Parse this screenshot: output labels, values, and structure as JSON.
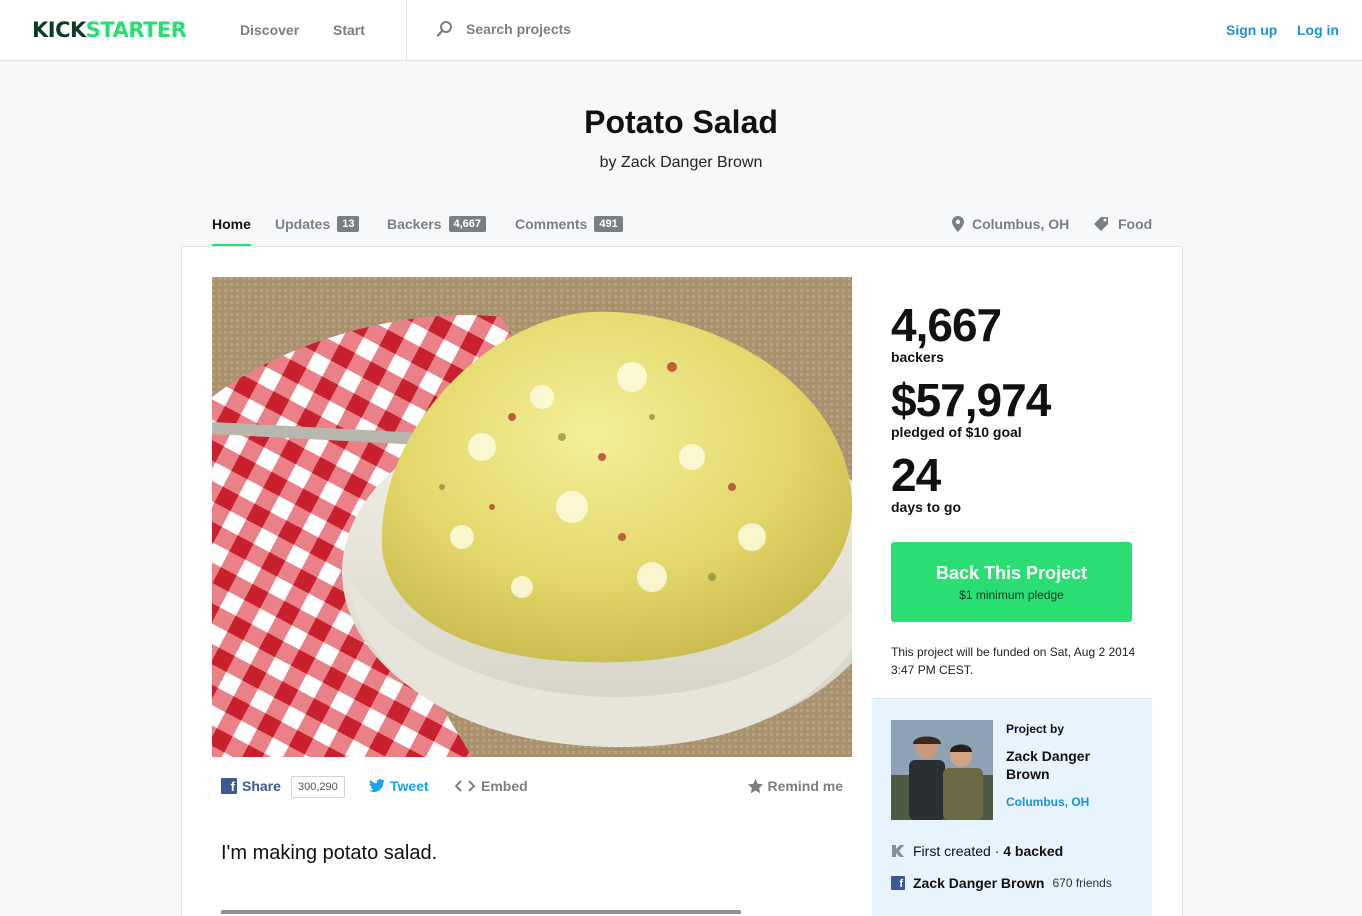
{
  "header": {
    "logo_part1": "KICK",
    "logo_part2": "STARTER",
    "nav": [
      "Discover",
      "Start"
    ],
    "search_placeholder": "Search projects",
    "signup": "Sign up",
    "login": "Log in"
  },
  "project": {
    "title": "Potato Salad",
    "byline": "by Zack Danger Brown"
  },
  "tabs": [
    {
      "label": "Home",
      "count": ""
    },
    {
      "label": "Updates",
      "count": "13"
    },
    {
      "label": "Backers",
      "count": "4,667"
    },
    {
      "label": "Comments",
      "count": "491"
    }
  ],
  "meta": {
    "location": "Columbus, OH",
    "category": "Food"
  },
  "stats": {
    "backers": "4,667",
    "backers_label": "backers",
    "pledged": "$57,974",
    "pledged_label": "pledged of $10 goal",
    "days": "24",
    "days_label": "days to go"
  },
  "back_button": {
    "title": "Back This Project",
    "subtitle": "$1 minimum pledge"
  },
  "funding_note": "This project will be funded on Sat, Aug 2 2014 3:47 PM CEST.",
  "share": {
    "facebook": "Share",
    "facebook_count": "300,290",
    "tweet": "Tweet",
    "embed": "Embed",
    "remind": "Remind me"
  },
  "blurb": "I'm making potato salad.",
  "creator": {
    "label": "Project by",
    "name": "Zack Danger Brown",
    "location": "Columbus, OH",
    "first_created": "First created · ",
    "backed": "4 backed",
    "fb_name": "Zack Danger Brown",
    "fb_friends": "670 friends"
  },
  "colors": {
    "brand_green": "#2bde73",
    "brand_dark": "#0f3b22",
    "link_blue": "#1a93d6",
    "facebook": "#3b5998",
    "twitter": "#1da1f2"
  }
}
